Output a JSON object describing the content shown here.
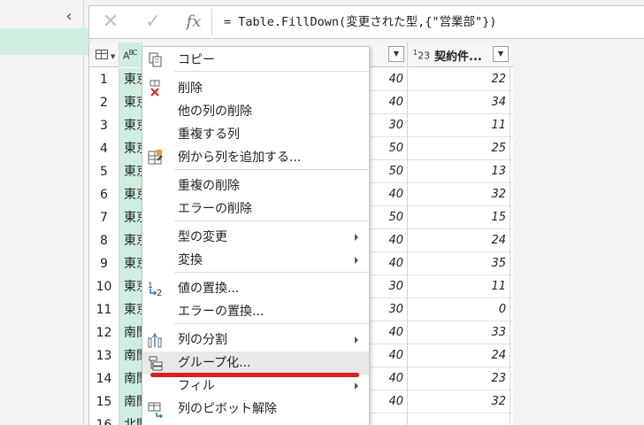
{
  "formula_bar": {
    "cancel_glyph": "✕",
    "commit_glyph": "✓",
    "fx_label": "fx",
    "formula": "= Table.FillDown(変更された型,{\"営業部\"})"
  },
  "grid": {
    "col_type_text": "ABC",
    "col_type_number": "123",
    "col_header_c": "契約件...",
    "rows": [
      {
        "n": "1",
        "a": "東京",
        "b": "40",
        "c": "22"
      },
      {
        "n": "2",
        "a": "東京",
        "b": "40",
        "c": "34"
      },
      {
        "n": "3",
        "a": "東京",
        "b": "30",
        "c": "11"
      },
      {
        "n": "4",
        "a": "東京",
        "b": "50",
        "c": "25"
      },
      {
        "n": "5",
        "a": "東京",
        "b": "50",
        "c": "13"
      },
      {
        "n": "6",
        "a": "東京",
        "b": "40",
        "c": "32"
      },
      {
        "n": "7",
        "a": "東京",
        "b": "50",
        "c": "15"
      },
      {
        "n": "8",
        "a": "東京",
        "b": "40",
        "c": "24"
      },
      {
        "n": "9",
        "a": "東京",
        "b": "40",
        "c": "35"
      },
      {
        "n": "10",
        "a": "東京",
        "b": "30",
        "c": "11"
      },
      {
        "n": "11",
        "a": "東京",
        "b": "30",
        "c": "0"
      },
      {
        "n": "12",
        "a": "南関",
        "b": "40",
        "c": "33"
      },
      {
        "n": "13",
        "a": "南関",
        "b": "40",
        "c": "24"
      },
      {
        "n": "14",
        "a": "南関",
        "b": "40",
        "c": "23"
      },
      {
        "n": "15",
        "a": "南関",
        "b": "40",
        "c": "32"
      },
      {
        "n": "16",
        "a": "北関",
        "b": "",
        "c": ""
      }
    ]
  },
  "menu": {
    "items": [
      {
        "id": "copy",
        "label": "コピー",
        "icon": "copy-icon",
        "submenu": false
      },
      {
        "id": "delete",
        "label": "削除",
        "icon": "delete-column-icon",
        "submenu": false
      },
      {
        "id": "delete-others",
        "label": "他の列の削除",
        "icon": "",
        "submenu": false
      },
      {
        "id": "duplicate",
        "label": "重複する列",
        "icon": "",
        "submenu": false
      },
      {
        "id": "from-examples",
        "label": "例から列を追加する...",
        "icon": "column-from-examples-icon",
        "submenu": false
      },
      {
        "id": "remove-duplicates",
        "label": "重複の削除",
        "icon": "",
        "submenu": false
      },
      {
        "id": "remove-errors",
        "label": "エラーの削除",
        "icon": "",
        "submenu": false
      },
      {
        "id": "change-type",
        "label": "型の変更",
        "icon": "",
        "submenu": true
      },
      {
        "id": "transform",
        "label": "変換",
        "icon": "",
        "submenu": true
      },
      {
        "id": "replace-values",
        "label": "値の置換...",
        "icon": "replace-values-icon",
        "submenu": false
      },
      {
        "id": "replace-errors",
        "label": "エラーの置換...",
        "icon": "",
        "submenu": false
      },
      {
        "id": "split-column",
        "label": "列の分割",
        "icon": "split-column-icon",
        "submenu": true
      },
      {
        "id": "group-by",
        "label": "グループ化...",
        "icon": "group-by-icon",
        "submenu": false,
        "highlighted": true
      },
      {
        "id": "fill",
        "label": "フィル",
        "icon": "",
        "submenu": true
      },
      {
        "id": "unpivot",
        "label": "列のピボット解除",
        "icon": "unpivot-icon",
        "submenu": false
      }
    ]
  },
  "colors": {
    "selected_column": "#cfeee0",
    "annotation_red": "#d9211f"
  }
}
